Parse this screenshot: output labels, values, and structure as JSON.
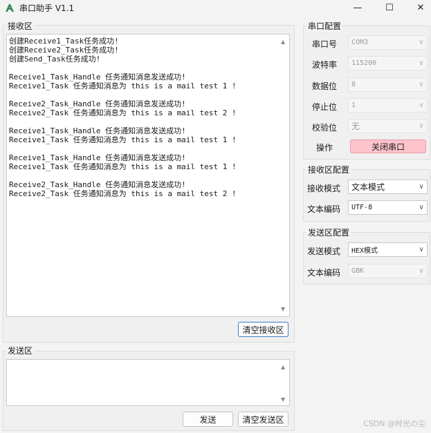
{
  "window": {
    "title": "串口助手 V1.1",
    "minimize": "—",
    "maximize": "☐",
    "close": "✕"
  },
  "receive": {
    "group_label": "接收区",
    "lines": [
      "创建Receive1_Task任务成功!",
      "创建Receive2_Task任务成功!",
      "创建Send_Task任务成功!",
      "",
      "Receive1_Task_Handle 任务通知消息发送成功!",
      "Receive1_Task 任务通知消息为 this is a mail test 1 !",
      "",
      "Receive2_Task_Handle 任务通知消息发送成功!",
      "Receive2_Task 任务通知消息为 this is a mail test 2 !",
      "",
      "Receive1_Task_Handle 任务通知消息发送成功!",
      "Receive1_Task 任务通知消息为 this is a mail test 1 !",
      "",
      "Receive1_Task_Handle 任务通知消息发送成功!",
      "Receive1_Task 任务通知消息为 this is a mail test 1 !",
      "",
      "Receive2_Task_Handle 任务通知消息发送成功!",
      "Receive2_Task 任务通知消息为 this is a mail test 2 !"
    ],
    "clear_button": "清空接收区"
  },
  "send": {
    "group_label": "发送区",
    "send_button": "发送",
    "clear_button": "清空发送区"
  },
  "serial_config": {
    "group_label": "串口配置",
    "port_label": "串口号",
    "port_value": "COM3",
    "baud_label": "波特率",
    "baud_value": "115200",
    "databits_label": "数据位",
    "databits_value": "8",
    "stopbits_label": "停止位",
    "stopbits_value": "1",
    "parity_label": "校验位",
    "parity_value": "无",
    "operation_label": "操作",
    "operation_button": "关闭串口"
  },
  "receive_config": {
    "group_label": "接收区配置",
    "mode_label": "接收模式",
    "mode_value": "文本模式",
    "encoding_label": "文本编码",
    "encoding_value": "UTF-8"
  },
  "send_config": {
    "group_label": "发送区配置",
    "mode_label": "发送模式",
    "mode_value": "HEX模式",
    "encoding_label": "文本编码",
    "encoding_value": "GBK"
  },
  "watermark": "CSDN @时光の尘",
  "icons": {
    "app": "app-logo-icon",
    "scroll_up": "▲",
    "scroll_down": "▼",
    "chevron": "∨"
  }
}
